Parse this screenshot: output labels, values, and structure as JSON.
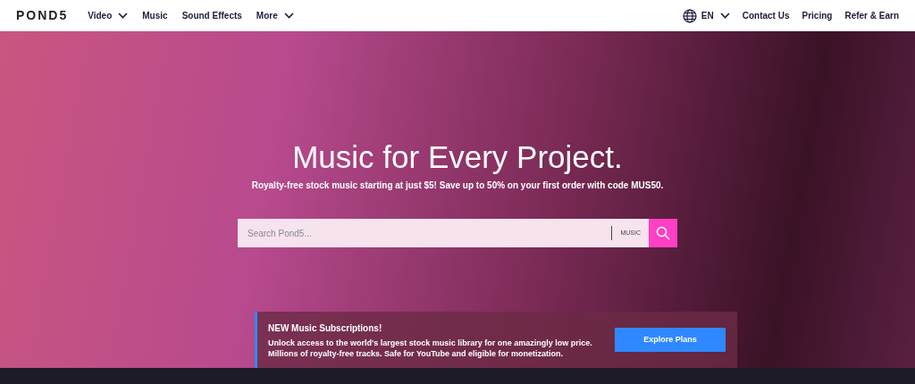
{
  "nav": {
    "logo": "POND5",
    "left_items": [
      {
        "label": "Video",
        "dropdown": true
      },
      {
        "label": "Music",
        "dropdown": false
      },
      {
        "label": "Sound Effects",
        "dropdown": false
      },
      {
        "label": "More",
        "dropdown": true
      }
    ],
    "language": "EN",
    "right_items": [
      "Contact Us",
      "Pricing",
      "Refer & Earn"
    ]
  },
  "hero": {
    "title": "Music for Every Project.",
    "subtitle": "Royalty-free stock music starting at just $5! Save up to 50% on your first order with code MUS50.",
    "search": {
      "placeholder": "Search Pond5...",
      "category": "MUSIC"
    }
  },
  "banner": {
    "title": "NEW Music Subscriptions!",
    "lines": [
      "Unlock access to the world's largest stock music library for one amazingly low price.",
      "Millions of royalty-free tracks. Safe for YouTube and eligible for monetization."
    ],
    "button": "Explore Plans"
  }
}
